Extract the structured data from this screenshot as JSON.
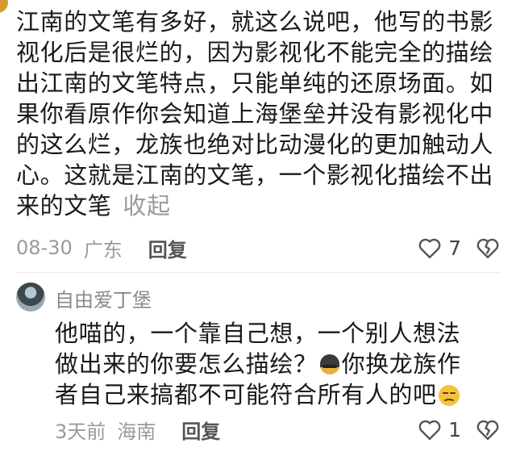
{
  "comment": {
    "text": "江南的文笔有多好，就这么说吧，他写的书影视化后是很烂的，因为影视化不能完全的描绘出江南的文笔特点，只能单纯的还原场面。如果你看原作你会知道上海堡垒并没有影视化中的这么烂，龙族也绝对比动漫化的更加触动人心。这就是江南的文笔，一个影视化描绘不出来的文笔",
    "collapse_label": "收起",
    "date": "08-30",
    "location": "广东",
    "reply_label": "回复",
    "like_count": "7",
    "like_icon": "heart-outline-icon",
    "dislike_icon": "broken-heart-icon"
  },
  "reply": {
    "username": "自由爱丁堡",
    "text_part1": "他喵的，一个靠自己想，一个别人想法做出来的你要怎么描绘？",
    "emoji_1": "helmet-emoji",
    "text_part2": "你换龙族作者自己来搞都不可能符合所有人的吧",
    "emoji_2": "unamused-face-emoji",
    "time": "3天前",
    "location": "海南",
    "reply_label": "回复",
    "like_count": "1",
    "like_icon": "heart-outline-icon",
    "dislike_icon": "broken-heart-icon"
  }
}
